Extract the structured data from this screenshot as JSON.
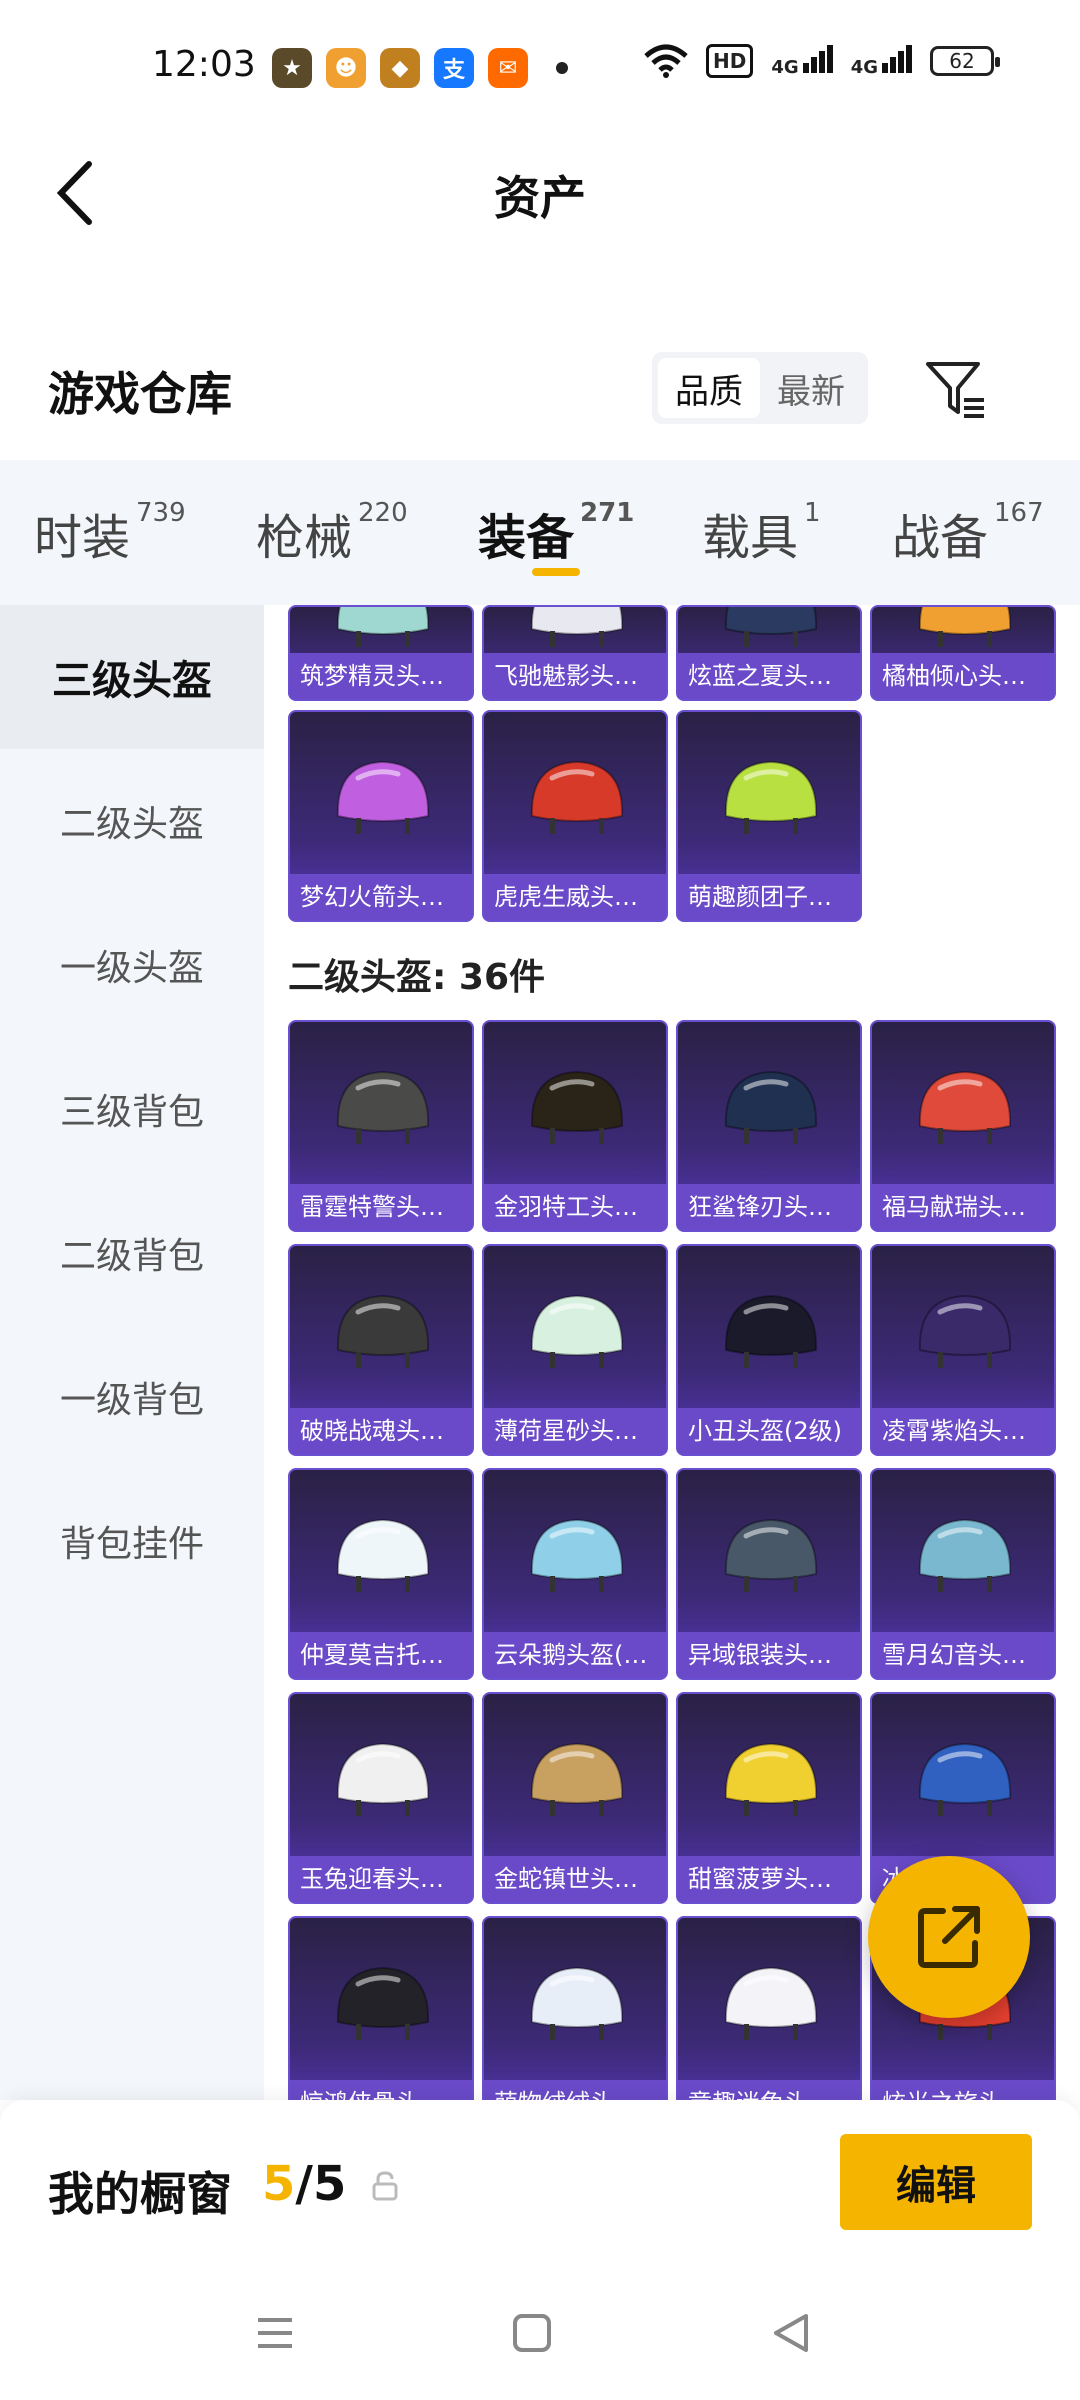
{
  "status_bar": {
    "time": "12:03",
    "app_icons": [
      {
        "name": "game-app-icon",
        "color": "#5a4a2a",
        "glyph": "★"
      },
      {
        "name": "mascot-app-icon",
        "color": "#f0a030",
        "glyph": "☻"
      },
      {
        "name": "game-app2-icon",
        "color": "#c08020",
        "glyph": "◆"
      },
      {
        "name": "alipay-app-icon",
        "color": "#1677ff",
        "glyph": "支"
      },
      {
        "name": "shopping-app-icon",
        "color": "#ff6a00",
        "glyph": "✉"
      }
    ],
    "hd_badge": "HD",
    "network_1": "4G",
    "network_2": "4G",
    "battery": "62"
  },
  "nav": {
    "title": "资产"
  },
  "section": {
    "title": "游戏仓库",
    "sort_options": [
      "品质",
      "最新"
    ],
    "sort_active": "品质"
  },
  "tabs": [
    {
      "label": "时装",
      "count": "739"
    },
    {
      "label": "枪械",
      "count": "220"
    },
    {
      "label": "装备",
      "count": "271"
    },
    {
      "label": "载具",
      "count": "1"
    },
    {
      "label": "战备",
      "count": "167"
    }
  ],
  "sidebar": {
    "items": [
      "三级头盔",
      "二级头盔",
      "一级头盔",
      "三级背包",
      "二级背包",
      "一级背包",
      "背包挂件"
    ],
    "active": "三级头盔"
  },
  "grid": {
    "top_row_cut": [
      "筑梦精灵头盔...",
      "飞驰魅影头盔...",
      "炫蓝之夏头盔...",
      "橘柚倾心头盔..."
    ],
    "level3_row": [
      "梦幻火箭头盔...",
      "虎虎生威头盔...",
      "萌趣颜团子头..."
    ],
    "group_label": "二级头盔: 36件",
    "level2_items": [
      "雷霆特警头盔...",
      "金羽特工头盔...",
      "狂鲨锋刃头盔...",
      "福马献瑞头盔...",
      "破晓战魂头盔...",
      "薄荷星砂头盔...",
      "小丑头盔(2级)",
      "凌霄紫焰头盔...",
      "仲夏莫吉托头...",
      "云朵鹅头盔(2...",
      "异域银装头盔...",
      "雪月幻音头盔...",
      "玉兔迎春头盔...",
      "金蛇镇世头盔...",
      "甜蜜菠萝头盔...",
      "冰",
      "惊鸿侠骨头盔...",
      "萌物绒绒头盔...",
      "童趣迷兔头盔...",
      "炫光之旅头盔..."
    ],
    "helmet_colors": {
      "top_row_cut": [
        "#9fd8d0",
        "#e8e8f0",
        "#2a3a60",
        "#f0a030"
      ],
      "level3_row": [
        "#c060e0",
        "#d83a2a",
        "#b8e040"
      ],
      "level2_items": [
        "#4a4a48",
        "#2a2418",
        "#203050",
        "#e04a3a",
        "#3a3a3a",
        "#d8f0e0",
        "#1a1a2a",
        "#3a2a6a",
        "#eef6fa",
        "#8fd0e8",
        "#485868",
        "#7ab8d0",
        "#f0f0f0",
        "#c8a060",
        "#f0d030",
        "#3060c0",
        "#222228",
        "#e8eef8",
        "#f4f4f8",
        "#e84030"
      ]
    }
  },
  "showcase": {
    "title": "我的橱窗",
    "current": "5",
    "separator": "/",
    "total": "5",
    "edit_label": "编辑"
  },
  "accent_color": "#f5b400"
}
